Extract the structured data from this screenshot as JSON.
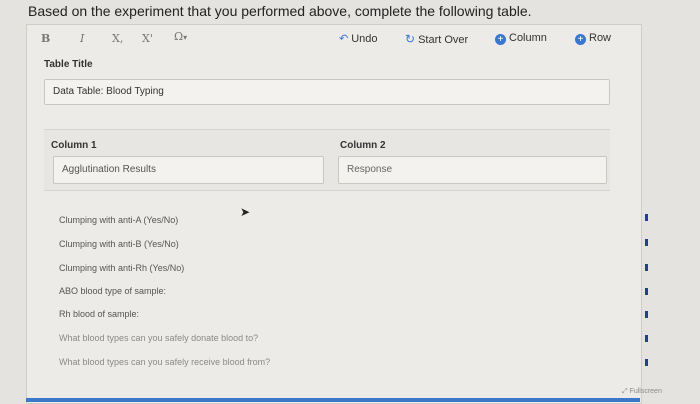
{
  "instruction": "Based on the experiment that you performed above, complete the following table.",
  "toolbar": {
    "bold": "B",
    "italic": "I",
    "subscript": "X,",
    "superscript": "X'",
    "symbol": "Ω",
    "symbol_dropdown": "▾",
    "undo_icon": "↶",
    "undo": "Undo",
    "start_over_icon": "↻",
    "start_over": "Start Over",
    "add_column_icon": "+",
    "add_column": "Column",
    "add_row_icon": "+",
    "add_row": "Row"
  },
  "table": {
    "title_label": "Table Title",
    "title_value": "Data Table: Blood Typing",
    "column1_label": "Column 1",
    "column1_value": "Agglutination Results",
    "column2_label": "Column 2",
    "column2_placeholder": "Response"
  },
  "rows": [
    "Clumping with anti-A (Yes/No)",
    "Clumping with anti-B (Yes/No)",
    "Clumping with anti-Rh (Yes/No)",
    "ABO blood type of sample:",
    "Rh blood of sample:",
    "What blood types can you safely donate blood to?",
    "What blood types can you safely receive blood from?"
  ],
  "fullscreen": "Fullscreen",
  "colors": {
    "accent": "#3a75d3",
    "row_marker": "#1f3e9c"
  }
}
